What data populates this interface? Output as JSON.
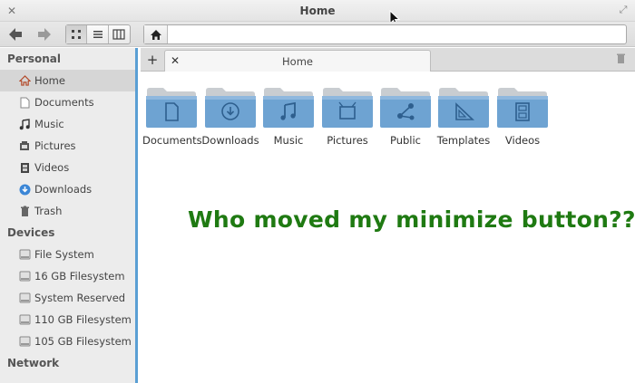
{
  "window": {
    "title": "Home"
  },
  "tabs": [
    {
      "label": "Home"
    }
  ],
  "sidebar": {
    "sections": [
      {
        "label": "Personal",
        "items": [
          {
            "label": "Home",
            "icon": "home-icon",
            "selected": true
          },
          {
            "label": "Documents",
            "icon": "document-icon"
          },
          {
            "label": "Music",
            "icon": "music-note-icon"
          },
          {
            "label": "Pictures",
            "icon": "pictures-icon"
          },
          {
            "label": "Videos",
            "icon": "film-icon"
          },
          {
            "label": "Downloads",
            "icon": "download-icon"
          },
          {
            "label": "Trash",
            "icon": "trash-icon"
          }
        ]
      },
      {
        "label": "Devices",
        "items": [
          {
            "label": "File System",
            "icon": "drive-icon"
          },
          {
            "label": "16 GB Filesystem",
            "icon": "drive-icon"
          },
          {
            "label": "System Reserved",
            "icon": "drive-icon"
          },
          {
            "label": "110 GB Filesystem",
            "icon": "drive-icon"
          },
          {
            "label": "105 GB Filesystem",
            "icon": "drive-icon"
          }
        ]
      },
      {
        "label": "Network",
        "items": []
      }
    ]
  },
  "folders": [
    {
      "label": "Documents",
      "icon": "document-icon"
    },
    {
      "label": "Downloads",
      "icon": "download-icon"
    },
    {
      "label": "Music",
      "icon": "music-note-icon"
    },
    {
      "label": "Pictures",
      "icon": "pictures-icon"
    },
    {
      "label": "Public",
      "icon": "share-icon"
    },
    {
      "label": "Templates",
      "icon": "ruler-icon"
    },
    {
      "label": "Videos",
      "icon": "film-icon"
    }
  ],
  "annotation": "Who moved my minimize button??",
  "colors": {
    "accent": "#5a9fd4",
    "folder": "#6a9fcf",
    "annotation": "#1f7a12"
  }
}
